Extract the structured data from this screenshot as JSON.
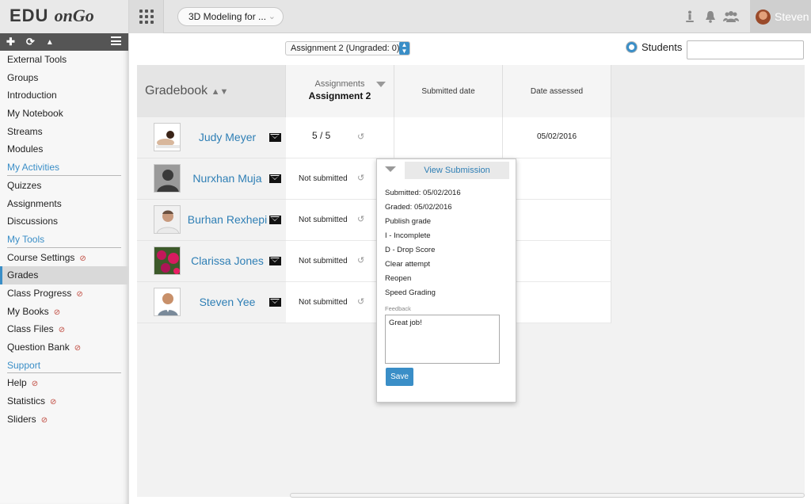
{
  "topbar": {
    "logo_prefix": "EDU",
    "logo_script": "onGo",
    "course_select": "3D Modeling for ...",
    "user_name": "Steven"
  },
  "sidebar": {
    "items": [
      {
        "label": "External Tools",
        "kind": "item"
      },
      {
        "label": "Groups",
        "kind": "item"
      },
      {
        "label": "Introduction",
        "kind": "item"
      },
      {
        "label": "My Notebook",
        "kind": "item"
      },
      {
        "label": "Streams",
        "kind": "item"
      },
      {
        "label": "Modules",
        "kind": "item"
      },
      {
        "label": "My Activities",
        "kind": "section"
      },
      {
        "label": "Quizzes",
        "kind": "item"
      },
      {
        "label": "Assignments",
        "kind": "item"
      },
      {
        "label": "Discussions",
        "kind": "item"
      },
      {
        "label": "My Tools",
        "kind": "section"
      },
      {
        "label": "Course Settings",
        "kind": "item",
        "hidden_icon": true
      },
      {
        "label": "Grades",
        "kind": "item",
        "active": true
      },
      {
        "label": "Class Progress",
        "kind": "item",
        "hidden_icon": true
      },
      {
        "label": "My Books",
        "kind": "item",
        "hidden_icon": true
      },
      {
        "label": "Class Files",
        "kind": "item",
        "hidden_icon": true
      },
      {
        "label": "Question Bank",
        "kind": "item",
        "hidden_icon": true
      },
      {
        "label": "Support",
        "kind": "section"
      },
      {
        "label": "Help",
        "kind": "item",
        "hidden_icon": true
      },
      {
        "label": "Statistics",
        "kind": "item",
        "hidden_icon": true
      },
      {
        "label": "Sliders",
        "kind": "item",
        "hidden_icon": true
      }
    ]
  },
  "toolbar": {
    "assignment_select": "Assignment 2 (Ungraded: 0)",
    "students_label": "Students",
    "search_value": ""
  },
  "gradebook": {
    "title": "Gradebook",
    "assignments_label": "Assignments",
    "assignment_title": "Assignment 2",
    "submitted_date_label": "Submitted date",
    "date_assessed_label": "Date assessed",
    "rows": [
      {
        "name": "Judy Meyer",
        "grade": "5 / 5",
        "date_assessed": "05/02/2016"
      },
      {
        "name": "Nurxhan Muja",
        "status": "Not submitted"
      },
      {
        "name": "Burhan Rexhepi",
        "status": "Not submitted"
      },
      {
        "name": "Clarissa Jones",
        "status": "Not submitted"
      },
      {
        "name": "Steven Yee",
        "status": "Not submitted"
      }
    ]
  },
  "popup": {
    "view_submission": "View Submission",
    "options": [
      "Submitted: 05/02/2016",
      "Graded: 05/02/2016",
      "Publish grade",
      "I - Incomplete",
      "D - Drop Score",
      "Clear attempt",
      "Reopen",
      "Speed Grading"
    ],
    "feedback_label": "Feedback",
    "feedback_value": "Great job!",
    "save_label": "Save"
  },
  "colors": {
    "accent": "#3a8ec7",
    "link": "#2f7fb5",
    "sidebar_toolbar": "#555555"
  }
}
